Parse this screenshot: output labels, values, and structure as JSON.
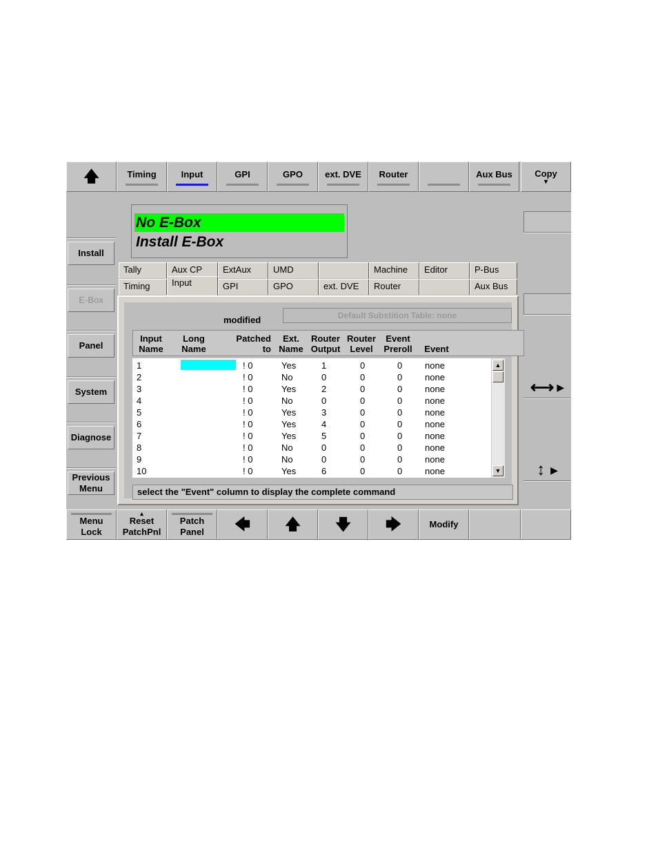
{
  "top_bar": {
    "up_arrow": "🡅",
    "tabs": [
      "Timing",
      "Input",
      "GPI",
      "GPO",
      "ext. DVE",
      "Router",
      "",
      "Aux Bus"
    ],
    "active_tab": "Input",
    "copy_label": "Copy",
    "copy_glyph": "▾"
  },
  "side": {
    "install": "Install",
    "ebox": "E-Box",
    "panel": "Panel",
    "system": "System",
    "diagnose": "Diagnose",
    "previous_line1": "Previous",
    "previous_line2": "Menu"
  },
  "status": {
    "line1": "No E-Box",
    "line2": "Install E-Box",
    "line1_bg": "#00ff00"
  },
  "tabs_row1": [
    "Tally",
    "Aux CP",
    "ExtAux",
    "UMD",
    "",
    "Machine",
    "Editor",
    "P-Bus"
  ],
  "tabs_row2": [
    "Timing",
    "Input",
    "GPI",
    "GPO",
    "ext. DVE",
    "Router",
    "",
    "Aux Bus"
  ],
  "panel": {
    "modified": "modified",
    "subst_table": "Default Substition Table: none",
    "headers": [
      [
        "Input",
        "Name"
      ],
      [
        "Long",
        "Name"
      ],
      [
        "Patched",
        "to"
      ],
      [
        "Ext.",
        "Name"
      ],
      [
        "Router",
        "Output"
      ],
      [
        "Router",
        "Level"
      ],
      [
        "Event",
        "Preroll"
      ],
      [
        "",
        "Event"
      ]
    ],
    "rows": [
      [
        "1",
        "",
        "! 0",
        "Yes",
        "1",
        "0",
        "0",
        "none"
      ],
      [
        "2",
        "",
        "! 0",
        "No",
        "0",
        "0",
        "0",
        "none"
      ],
      [
        "3",
        "",
        "! 0",
        "Yes",
        "2",
        "0",
        "0",
        "none"
      ],
      [
        "4",
        "",
        "! 0",
        "No",
        "0",
        "0",
        "0",
        "none"
      ],
      [
        "5",
        "",
        "! 0",
        "Yes",
        "3",
        "0",
        "0",
        "none"
      ],
      [
        "6",
        "",
        "! 0",
        "Yes",
        "4",
        "0",
        "0",
        "none"
      ],
      [
        "7",
        "",
        "! 0",
        "Yes",
        "5",
        "0",
        "0",
        "none"
      ],
      [
        "8",
        "",
        "! 0",
        "No",
        "0",
        "0",
        "0",
        "none"
      ],
      [
        "9",
        "",
        "! 0",
        "No",
        "0",
        "0",
        "0",
        "none"
      ],
      [
        "10",
        "",
        "! 0",
        "Yes",
        "6",
        "0",
        "0",
        "none"
      ]
    ],
    "selected_cell_color": "#00ffff",
    "hint": "select the \"Event\" column to display the complete command"
  },
  "bottom_bar": {
    "menu_lock_1": "Menu",
    "menu_lock_2": "Lock",
    "reset_glyph": "▴",
    "reset_1": "Reset",
    "reset_2": "PatchPnl",
    "patch_1": "Patch",
    "patch_2": "Panel",
    "left": "🡄",
    "up": "🡅",
    "down": "🡇",
    "right": "🡆",
    "modify": "Modify"
  },
  "right_side": {
    "horiz_arrow": "⟷",
    "vert_arrow": "↕",
    "pointer": "▶"
  }
}
